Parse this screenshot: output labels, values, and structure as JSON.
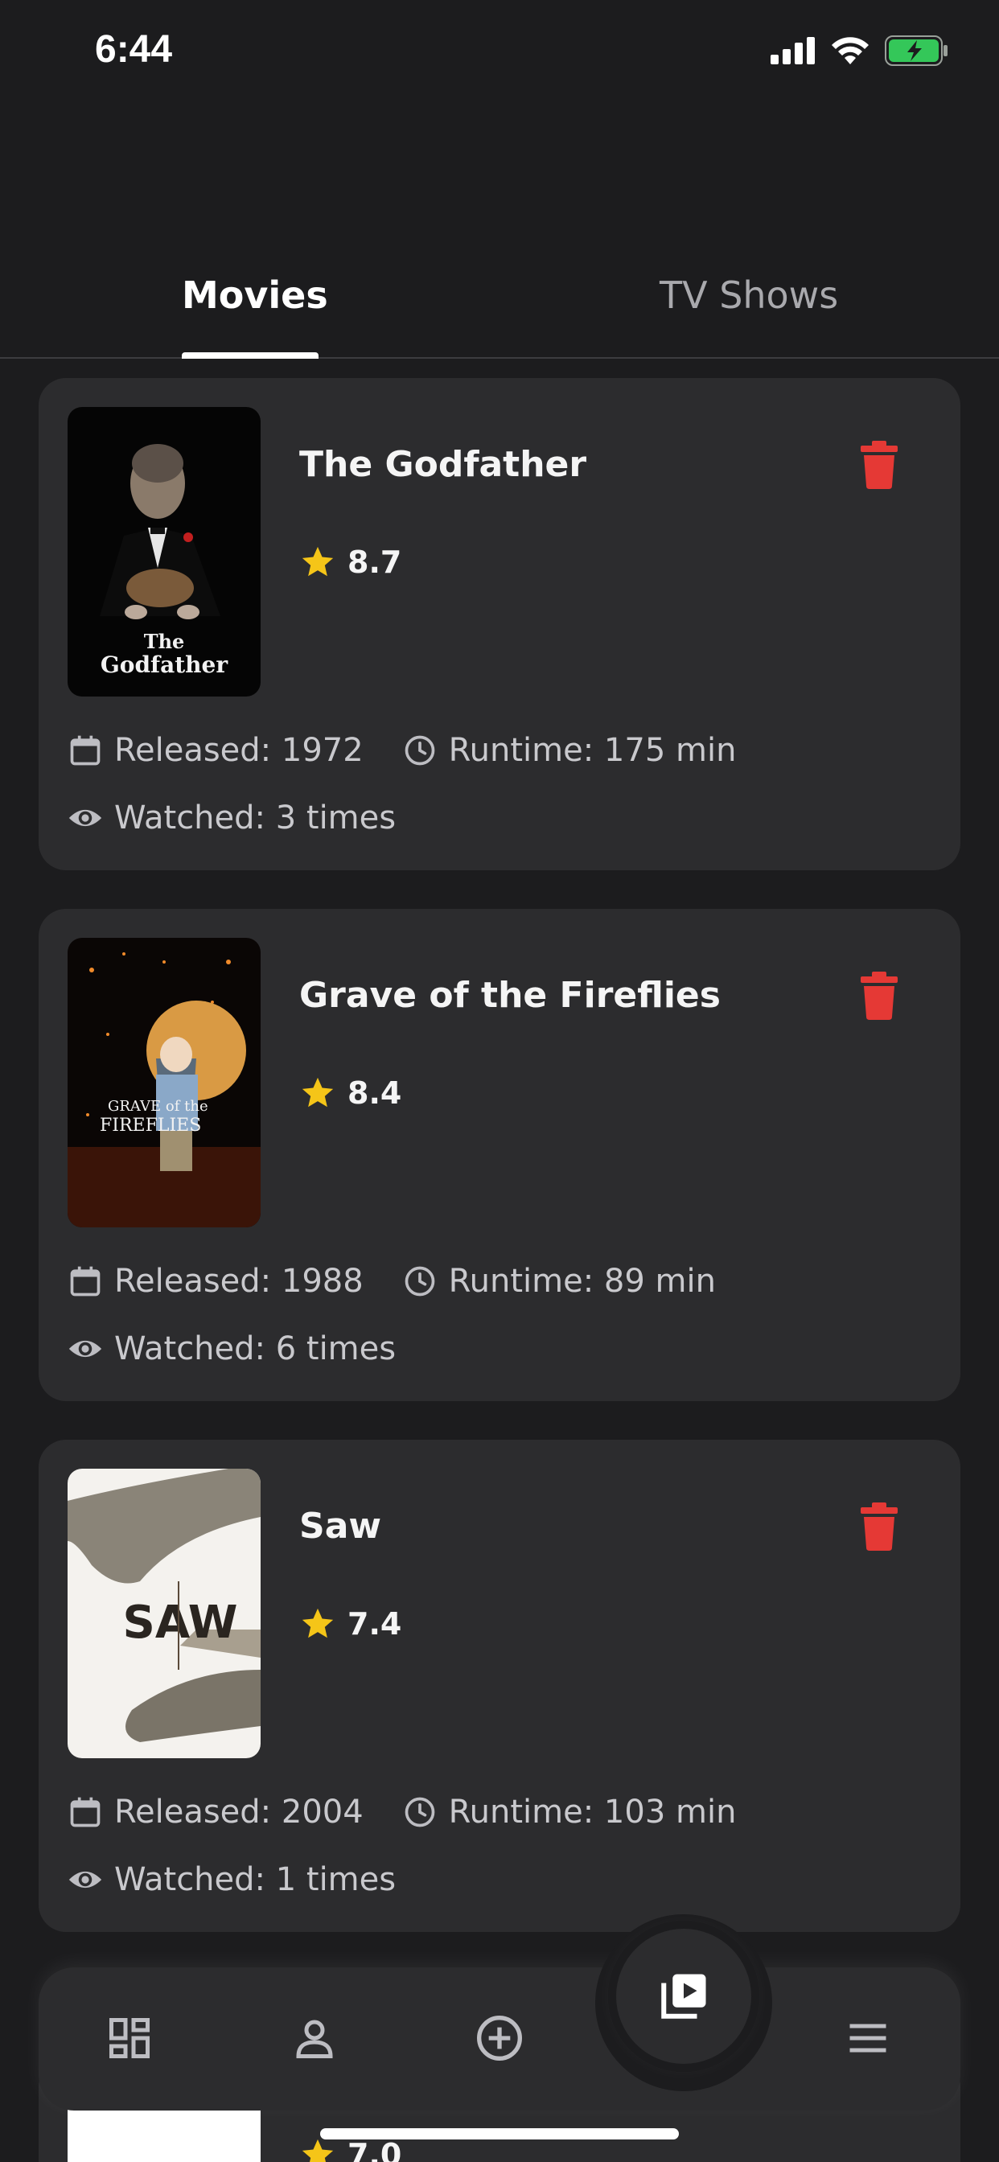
{
  "status_bar": {
    "time": "6:44"
  },
  "tabs": [
    {
      "label": "Movies",
      "active": true
    },
    {
      "label": "TV Shows",
      "active": false
    }
  ],
  "movies": [
    {
      "title": "The Godfather",
      "rating": "8.7",
      "released": "Released: 1972",
      "runtime": "Runtime: 175 min",
      "watched": "Watched: 3 times"
    },
    {
      "title": "Grave of the Fireflies",
      "rating": "8.4",
      "released": "Released: 1988",
      "runtime": "Runtime: 89 min",
      "watched": "Watched: 6 times"
    },
    {
      "title": "Saw",
      "rating": "7.4",
      "released": "Released: 2004",
      "runtime": "Runtime: 103 min",
      "watched": "Watched: 1 times"
    }
  ],
  "peek_rating": "7.0",
  "bottom_nav": [
    "dashboard-icon",
    "profile-icon",
    "add-icon",
    "watchlist-play-icon",
    "menu-icon"
  ],
  "colors": {
    "background": "#1c1c1e",
    "card": "#2c2c2e",
    "star": "#f5c518",
    "delete": "#e53935",
    "battery": "#34c759"
  }
}
